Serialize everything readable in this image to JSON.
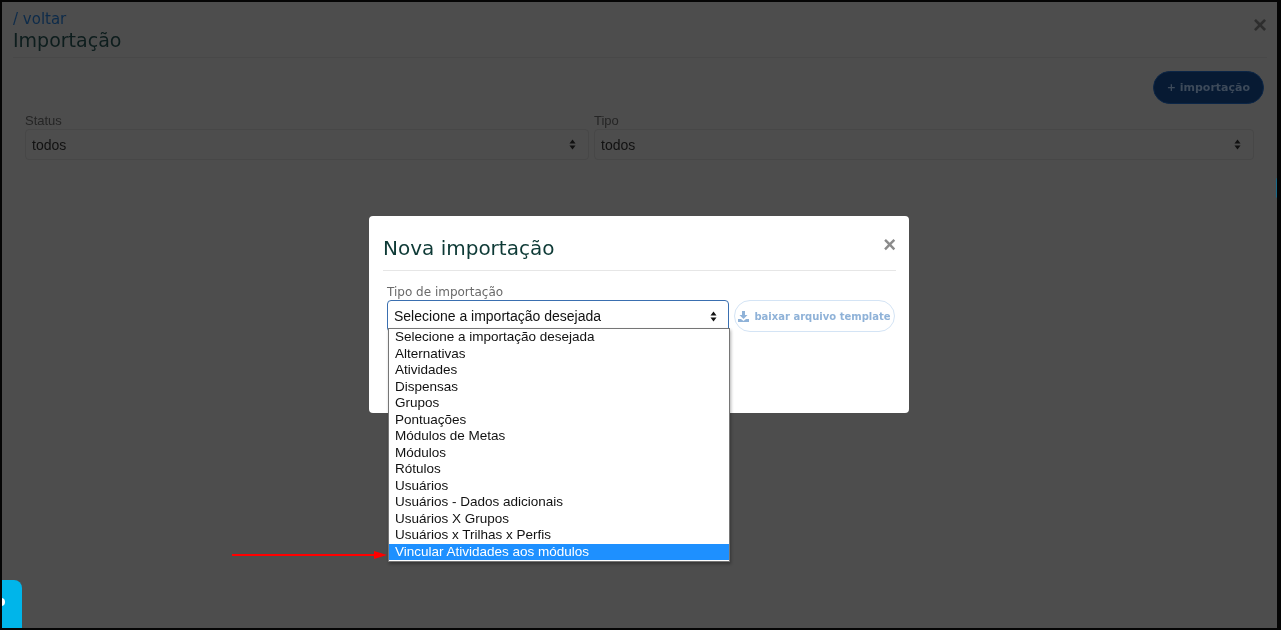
{
  "page": {
    "back_link": "/ voltar",
    "title": "Importação",
    "close": "×",
    "new_button": "+ importação"
  },
  "filters": [
    {
      "label": "Status",
      "value": "todos"
    },
    {
      "label": "Tipo",
      "value": "todos"
    }
  ],
  "modal": {
    "title": "Nova importação",
    "close": "×",
    "field_label": "Tipo de importação",
    "select_value": "Selecione a importação desejada",
    "template_button": {
      "label": "baixar arquivo template",
      "disabled": true
    },
    "options": [
      {
        "label": "Selecione a importação desejada",
        "selected": false
      },
      {
        "label": "Alternativas",
        "selected": false
      },
      {
        "label": "Atividades",
        "selected": false
      },
      {
        "label": "Dispensas",
        "selected": false
      },
      {
        "label": "Grupos",
        "selected": false
      },
      {
        "label": "Pontuações",
        "selected": false
      },
      {
        "label": "Módulos de Metas",
        "selected": false
      },
      {
        "label": "Módulos",
        "selected": false
      },
      {
        "label": "Rótulos",
        "selected": false
      },
      {
        "label": "Usuários",
        "selected": false
      },
      {
        "label": "Usuários - Dados adicionais",
        "selected": false
      },
      {
        "label": "Usuários X Grupos",
        "selected": false
      },
      {
        "label": "Usuários x Trilhas x Perfis",
        "selected": false
      },
      {
        "label": "Vincular Atividades aos módulos",
        "selected": true
      }
    ]
  }
}
